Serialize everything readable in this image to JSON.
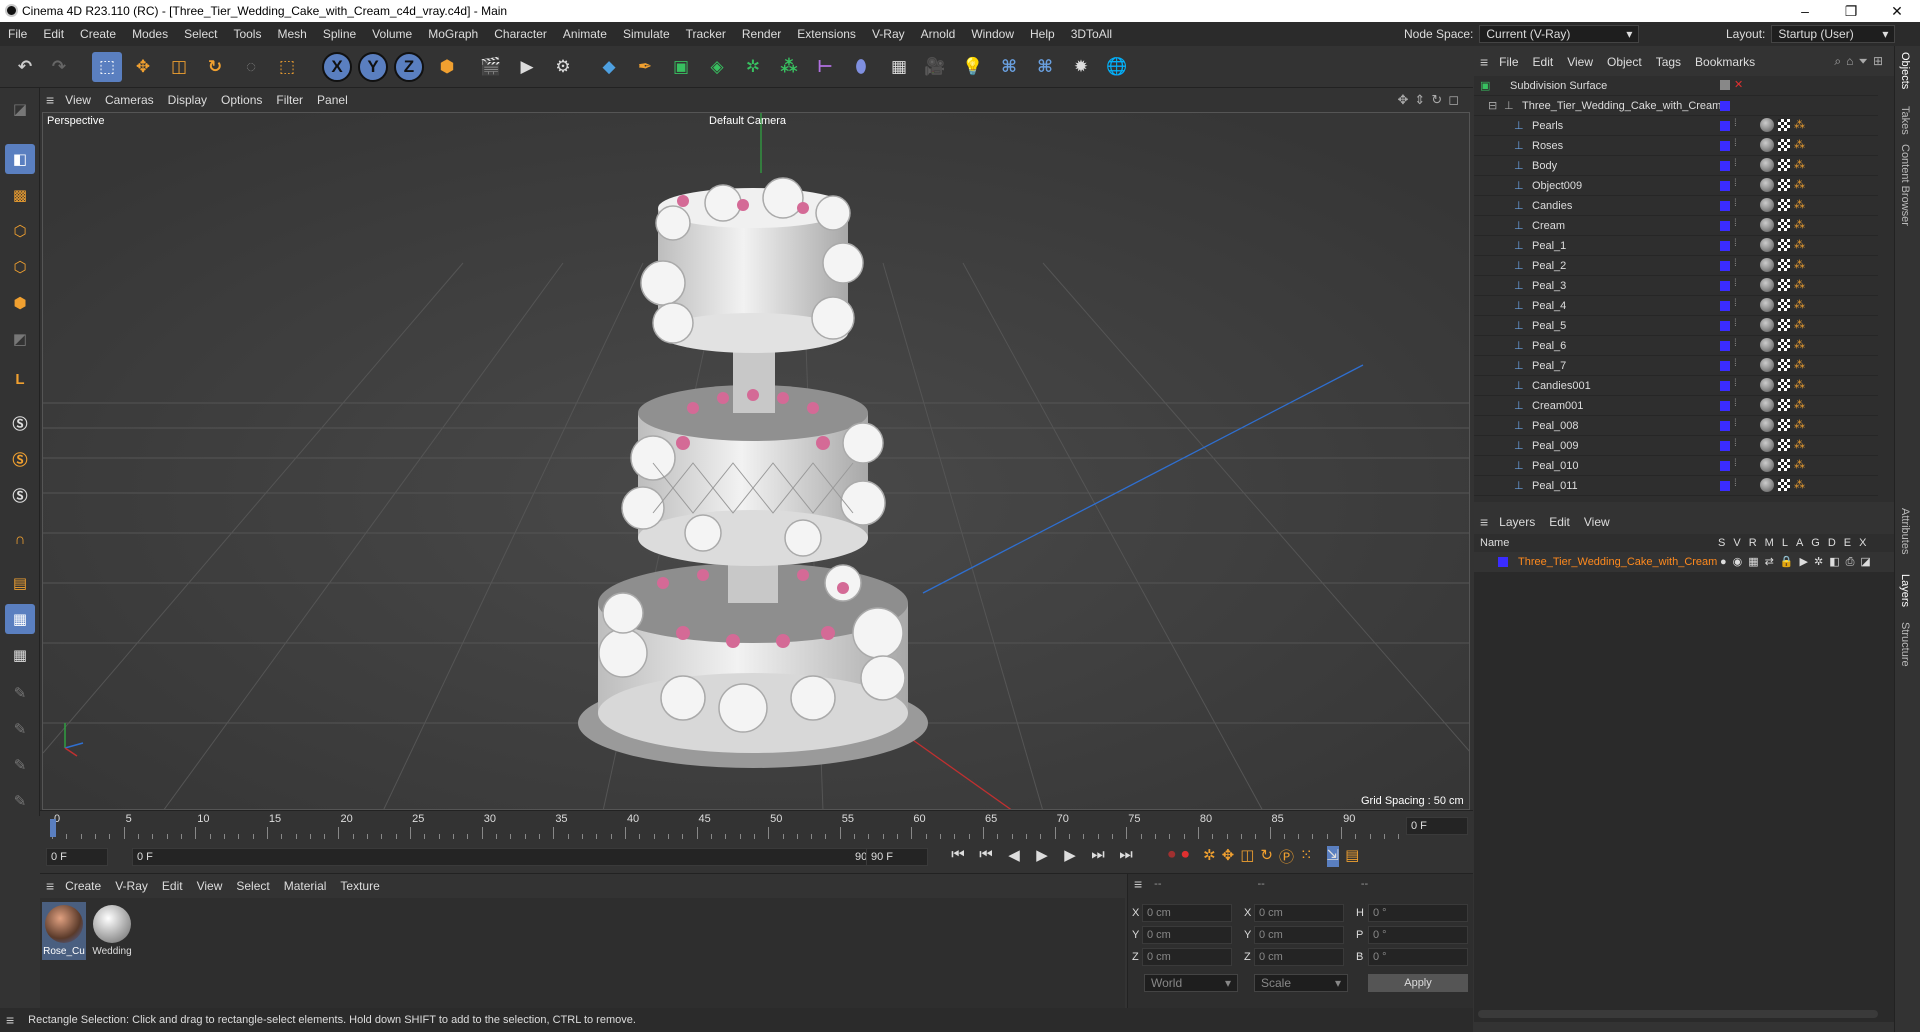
{
  "window": {
    "title": "Cinema 4D R23.110 (RC) - [Three_Tier_Wedding_Cake_with_Cream_c4d_vray.c4d] - Main",
    "minimize": "–",
    "maximize": "❐",
    "close": "✕"
  },
  "menu": [
    "File",
    "Edit",
    "Create",
    "Modes",
    "Select",
    "Tools",
    "Mesh",
    "Spline",
    "Volume",
    "MoGraph",
    "Character",
    "Animate",
    "Simulate",
    "Tracker",
    "Render",
    "Extensions",
    "V-Ray",
    "Arnold",
    "Window",
    "Help",
    "3DToAll"
  ],
  "header_right": {
    "node_space_label": "Node Space:",
    "node_space_value": "Current (V-Ray)",
    "layout_label": "Layout:",
    "layout_value": "Startup (User)"
  },
  "toolbar_axes": [
    "X",
    "Y",
    "Z"
  ],
  "viewport": {
    "menu": [
      "View",
      "Cameras",
      "Display",
      "Options",
      "Filter",
      "Panel"
    ],
    "label": "Perspective",
    "camera": "Default Camera",
    "grid_spacing": "Grid Spacing : 50 cm"
  },
  "timeline": {
    "ticks": [
      "0",
      "5",
      "10",
      "15",
      "20",
      "25",
      "30",
      "35",
      "40",
      "45",
      "50",
      "55",
      "60",
      "65",
      "70",
      "75",
      "80",
      "85",
      "90"
    ],
    "current_frame": "0 F",
    "start_frame": "0 F",
    "range_start": "0 F",
    "range_end": "90 F",
    "end_frame": "90 F"
  },
  "materials": {
    "menu": [
      "Create",
      "V-Ray",
      "Edit",
      "View",
      "Select",
      "Material",
      "Texture"
    ],
    "items": [
      {
        "name": "Rose_Cu"
      },
      {
        "name": "Wedding"
      }
    ]
  },
  "attributes": {
    "header": [
      "--",
      "--",
      "--"
    ],
    "rows": [
      {
        "a": "X",
        "av": "0 cm",
        "b": "X",
        "bv": "0 cm",
        "c": "H",
        "cv": "0 °"
      },
      {
        "a": "Y",
        "av": "0 cm",
        "b": "Y",
        "bv": "0 cm",
        "c": "P",
        "cv": "0 °"
      },
      {
        "a": "Z",
        "av": "0 cm",
        "b": "Z",
        "bv": "0 cm",
        "c": "B",
        "cv": "0 °"
      }
    ],
    "coord_mode": "World",
    "size_mode": "Scale",
    "apply": "Apply"
  },
  "status": "Rectangle Selection: Click and drag to rectangle-select elements. Hold down SHIFT to add to the selection, CTRL to remove.",
  "objects": {
    "menu": [
      "File",
      "Edit",
      "View",
      "Object",
      "Tags",
      "Bookmarks"
    ],
    "root": "Subdivision Surface",
    "group": "Three_Tier_Wedding_Cake_with_Cream",
    "items": [
      "Pearls",
      "Roses",
      "Body",
      "Object009",
      "Candies",
      "Cream",
      "Peal_1",
      "Peal_2",
      "Peal_3",
      "Peal_4",
      "Peal_5",
      "Peal_6",
      "Peal_7",
      "Candies001",
      "Cream001",
      "Peal_008",
      "Peal_009",
      "Peal_010",
      "Peal_011"
    ]
  },
  "layers": {
    "menu": [
      "Layers",
      "Edit",
      "View"
    ],
    "columns": {
      "name": "Name",
      "flags": [
        "S",
        "V",
        "R",
        "M",
        "L",
        "A",
        "G",
        "D",
        "E",
        "X"
      ]
    },
    "items": [
      {
        "name": "Three_Tier_Wedding_Cake_with_Cream",
        "color": "#3a2cff"
      }
    ]
  },
  "side_tabs": [
    "Objects",
    "Takes",
    "Content Browser",
    "Attributes",
    "Layers",
    "Structure"
  ],
  "colors": {
    "accent": "#3a2cff",
    "layer_text": "#ff8a1e",
    "selection": "#5a7fc0"
  }
}
